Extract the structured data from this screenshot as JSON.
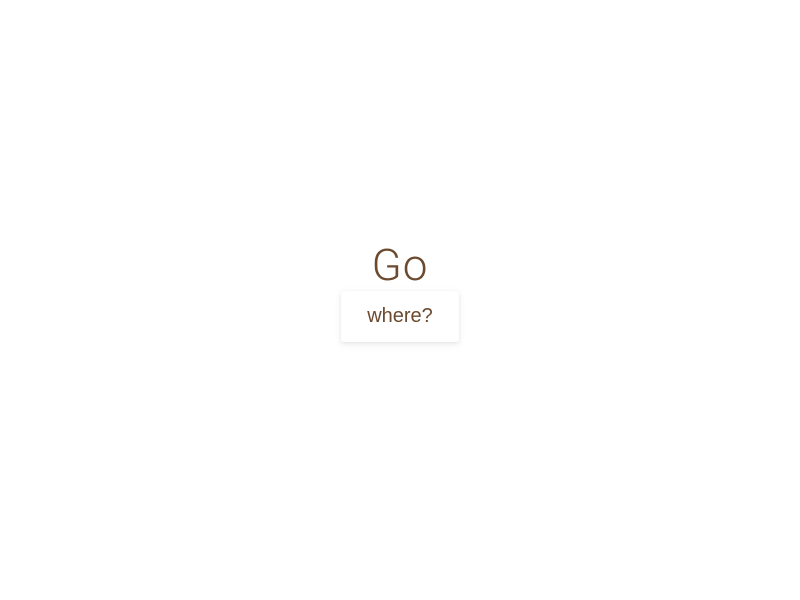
{
  "title": "Go",
  "button": {
    "label": "where?"
  }
}
